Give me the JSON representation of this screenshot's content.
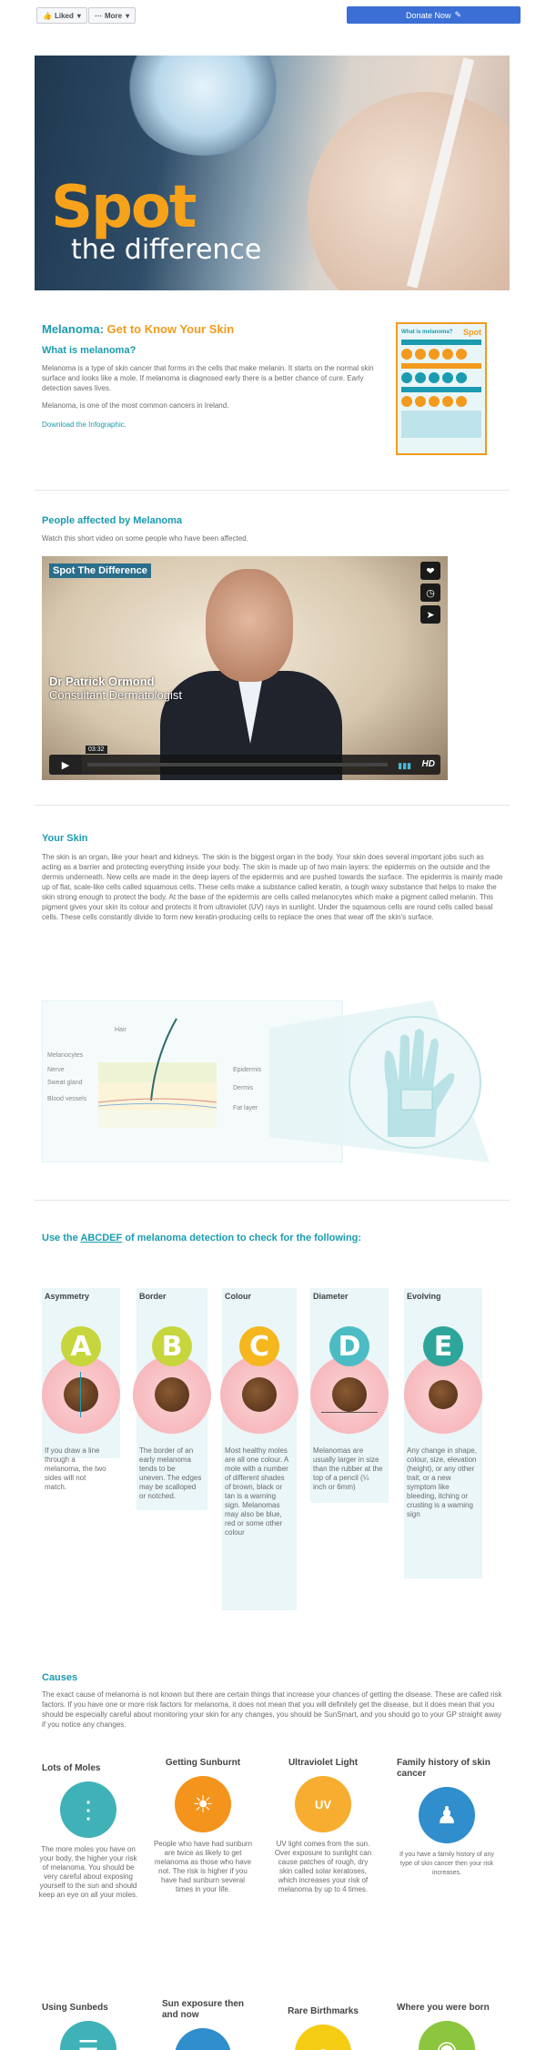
{
  "topbar": {
    "liked": "Liked",
    "more": "More",
    "donate": "Donate Now"
  },
  "hero": {
    "spot": "Spot",
    "difference": "the difference"
  },
  "intro": {
    "title_a": "Melanoma:",
    "title_b": "Get to Know Your Skin",
    "subtitle": "What is melanoma?",
    "p1": "Melanoma is a type of skin cancer that forms in the cells that make melanin. It starts on the normal skin surface and looks like a mole. If melanoma is diagnosed early there is a better chance of cure. Early detection saves lives.",
    "p2": "Melanoma, is one of the most common cancers in Ireland.",
    "download": "Download the Infographic."
  },
  "thumb": {
    "title": "What is melanoma?",
    "logo": "Spot"
  },
  "people": {
    "title": "People affected by Melanoma",
    "intro": "Watch this short video on some people who have been affected.",
    "video_tag": "Spot The Difference",
    "speaker_name": "Dr Patrick Ormond",
    "speaker_role": "Consultant Dermatologist",
    "time": "03:32",
    "hd": "HD"
  },
  "skin": {
    "title": "Your Skin",
    "body": "The skin is an organ, like your heart and kidneys. The skin is the biggest organ in the body. Your skin does several important jobs such as acting as a barrier and protecting everything inside your body. The skin is made up of two main layers: the epidermis on the outside and the dermis underneath. New cells are made in the deep layers of the epidermis and are pushed towards the surface. The epidermis is mainly made up of flat, scale-like cells called squamous cells. These cells make a substance called keratin, a tough waxy substance that helps to make the skin strong enough to protect the body. At the base of the epidermis are cells called melanocytes which make a pigment called melanin. This pigment gives your skin its colour and protects it from ultraviolet (UV) rays in sunlight. Under the squamous cells are round cells called basal cells. These cells constantly divide to form new keratin-producing cells to replace the ones that wear off the skin's surface.",
    "labels": {
      "hair": "Hair",
      "melanocytes": "Melanocytes",
      "nerve": "Nerve",
      "sweat": "Sweat gland",
      "blood": "Blood vessels",
      "epidermis": "Epidermis",
      "dermis": "Dermis",
      "fat": "Fat layer"
    }
  },
  "abcdef": {
    "title_pre": "Use the",
    "title_link": "ABCDEF",
    "title_post": "of melanoma detection to check for the following:",
    "items": [
      {
        "title": "Asymmetry",
        "letter": "A",
        "text": "If you draw a line through a melanoma, the two sides will not match."
      },
      {
        "title": "Border",
        "letter": "B",
        "text": "The border of an early melanoma tends to be uneven. The edges may be scalloped or notched."
      },
      {
        "title": "Colour",
        "letter": "C",
        "text": "Most healthy moles are all one colour. A mole with a number of different shades of brown, black or tan is a warning sign. Melanomas may also be blue, red or some other colour"
      },
      {
        "title": "Diameter",
        "letter": "D",
        "text": "Melanomas are usually larger in size than the rubber at the top of a pencil (¼ inch or 6mm)"
      },
      {
        "title": "Evolving",
        "letter": "E",
        "text": "Any change in shape, colour, size, elevation (height), or any other trait, or a new symptom like bleeding, itching or crusting is a warning sign"
      }
    ]
  },
  "causes": {
    "title": "Causes",
    "body": "The exact cause of melanoma is not known but there are certain things that increase your chances of getting the disease. These are called risk factors. If you have one or more risk factors for melanoma, it does not mean that you will definitely get the disease, but it does mean that you should be especially careful about monitoring your skin for any changes, you should be SunSmart, and you should go to your GP straight away if you notice any changes.",
    "items": [
      {
        "title": "Lots of Moles",
        "text": "The more moles you have on your body, the higher your risk of melanoma. You should be very careful about exposing yourself to the sun and should keep an eye on all your moles."
      },
      {
        "title": "Getting Sunburnt",
        "text": "People who have had sunburn are twice as likely to get melanoma as those who have not. The risk is higher if you have had sunburn several times in your life."
      },
      {
        "title": "Ultraviolet Light",
        "icon_text": "UV",
        "text": "UV light comes from the sun. Over exposure to sunlight can cause patches of rough, dry skin called solar keratoses, which increases your risk of melanoma by up to 4 times."
      },
      {
        "title": "Family history of skin cancer",
        "text": "If you have a family history of any type of skin cancer then your risk increases."
      }
    ],
    "more": [
      {
        "title": "Using Sunbeds"
      },
      {
        "title": "Sun exposure then and now"
      },
      {
        "title": "Rare Birthmarks"
      },
      {
        "title": "Where you were born"
      }
    ]
  },
  "colors": {
    "teal": "#1b9bb0",
    "orange": "#f39a1e",
    "blue": "#3b6fd6"
  }
}
